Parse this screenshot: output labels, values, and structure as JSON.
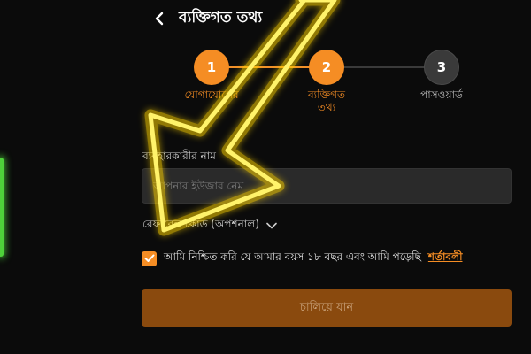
{
  "header": {
    "title": "ব্যক্তিগত তথ্য",
    "back_icon": "chevron-left-icon"
  },
  "steps": [
    {
      "number": "1",
      "label": "যোগাযোগের",
      "state": "done"
    },
    {
      "number": "2",
      "label": "ব্যক্তিগত তথ্য",
      "label_line1": "ব্যক্তিগত",
      "label_line2": "তথ্য",
      "state": "active"
    },
    {
      "number": "3",
      "label": "পাসওয়ার্ড",
      "state": "todo"
    }
  ],
  "username": {
    "label": "ব্যবহারকারীর নাম",
    "placeholder": "আপনার ইউজার নেম",
    "value": ""
  },
  "referral": {
    "label": "রেফারেল কোড (অপশনাল)",
    "icon": "chevron-down-icon"
  },
  "consent": {
    "checked": true,
    "text": "আমি নিশ্চিত করি যে আমার বয়স ১৮ বছর এবং আমি পড়েছি",
    "link_label": "শর্তাবলী"
  },
  "continue_button": {
    "label": "চালিয়ে যান"
  },
  "colors": {
    "accent": "#f58d24",
    "background": "#0b0b0b",
    "input_bg": "#2a2a2a",
    "button_disabled": "#8a4a0e",
    "highlight_arrow": "#ffe600",
    "side_glow": "#4ed13a"
  },
  "overlay": {
    "icon": "highlight-arrow-icon"
  }
}
